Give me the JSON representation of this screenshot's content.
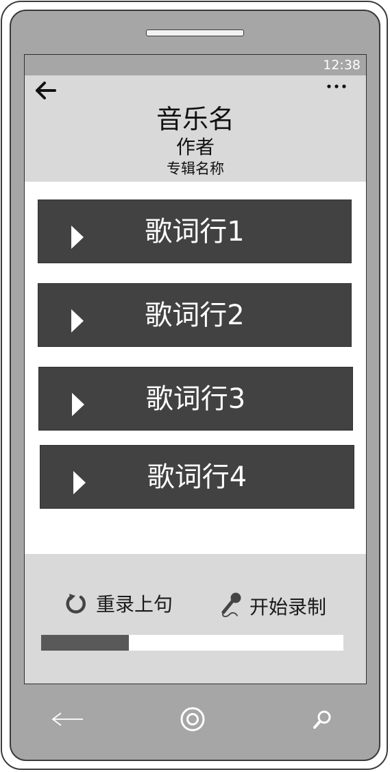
{
  "status_bar": {
    "time": "12:38"
  },
  "header": {
    "back_icon": "arrow-left-icon",
    "more_icon": "more-dots-icon",
    "title": "音乐名",
    "author": "作者",
    "album": "专辑名称"
  },
  "lyrics": [
    {
      "label": "歌词行1",
      "icon": "play-icon"
    },
    {
      "label": "歌词行2",
      "icon": "play-icon"
    },
    {
      "label": "歌词行3",
      "icon": "play-icon"
    },
    {
      "label": "歌词行4",
      "icon": "play-icon"
    }
  ],
  "controls": {
    "rerecord_label": "重录上句",
    "rerecord_icon": "redo-icon",
    "record_label": "开始录制",
    "record_icon": "microphone-icon",
    "progress_fraction": 0.29
  },
  "nav_bar": {
    "back_icon": "back-arrow-icon",
    "home_icon": "home-circle-icon",
    "search_icon": "search-icon"
  },
  "colors": {
    "phone_body": "#a6a6a6",
    "header_bg": "#d9d9d9",
    "lyric_bg": "#424242",
    "progress_fill": "#595959"
  }
}
